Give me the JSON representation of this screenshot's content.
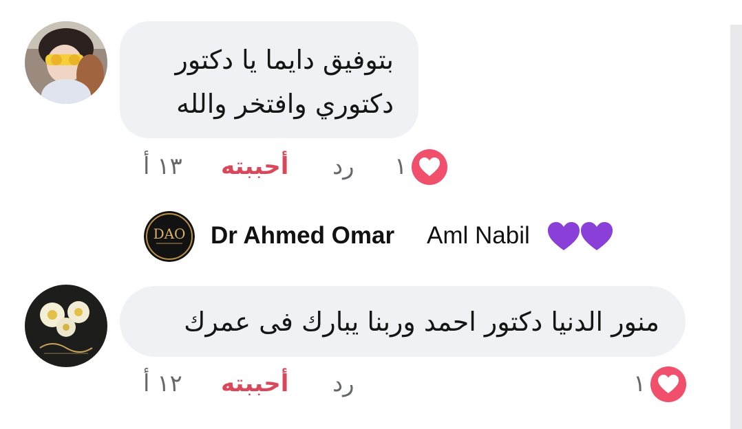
{
  "comments": [
    {
      "text": "بتوفيق دايما يا دكتور\nدكتوري وافتخر والله",
      "time": "١٣ أ",
      "like_label": "أحببته",
      "reply_label": "رد",
      "reaction_count": "١",
      "reaction_icon": "heart-icon"
    },
    {
      "text": "منور الدنيا دكتور احمد وربنا يبارك فى عمرك",
      "time": "١٢ أ",
      "like_label": "أحببته",
      "reply_label": "رد",
      "reaction_count": "١",
      "reaction_icon": "heart-icon"
    }
  ],
  "page_reply": {
    "author": "Dr Ahmed Omar",
    "mention": "Aml Nabil",
    "emoji": "purple-heart-icon purple-heart-icon",
    "avatar_monogram": "DAO"
  },
  "colors": {
    "bubble": "#f0f1f4",
    "like_text": "#d9475a",
    "heart_badge": "#f0506c",
    "secondary_text": "#65676b",
    "purple_heart": "#8b3fd9"
  }
}
